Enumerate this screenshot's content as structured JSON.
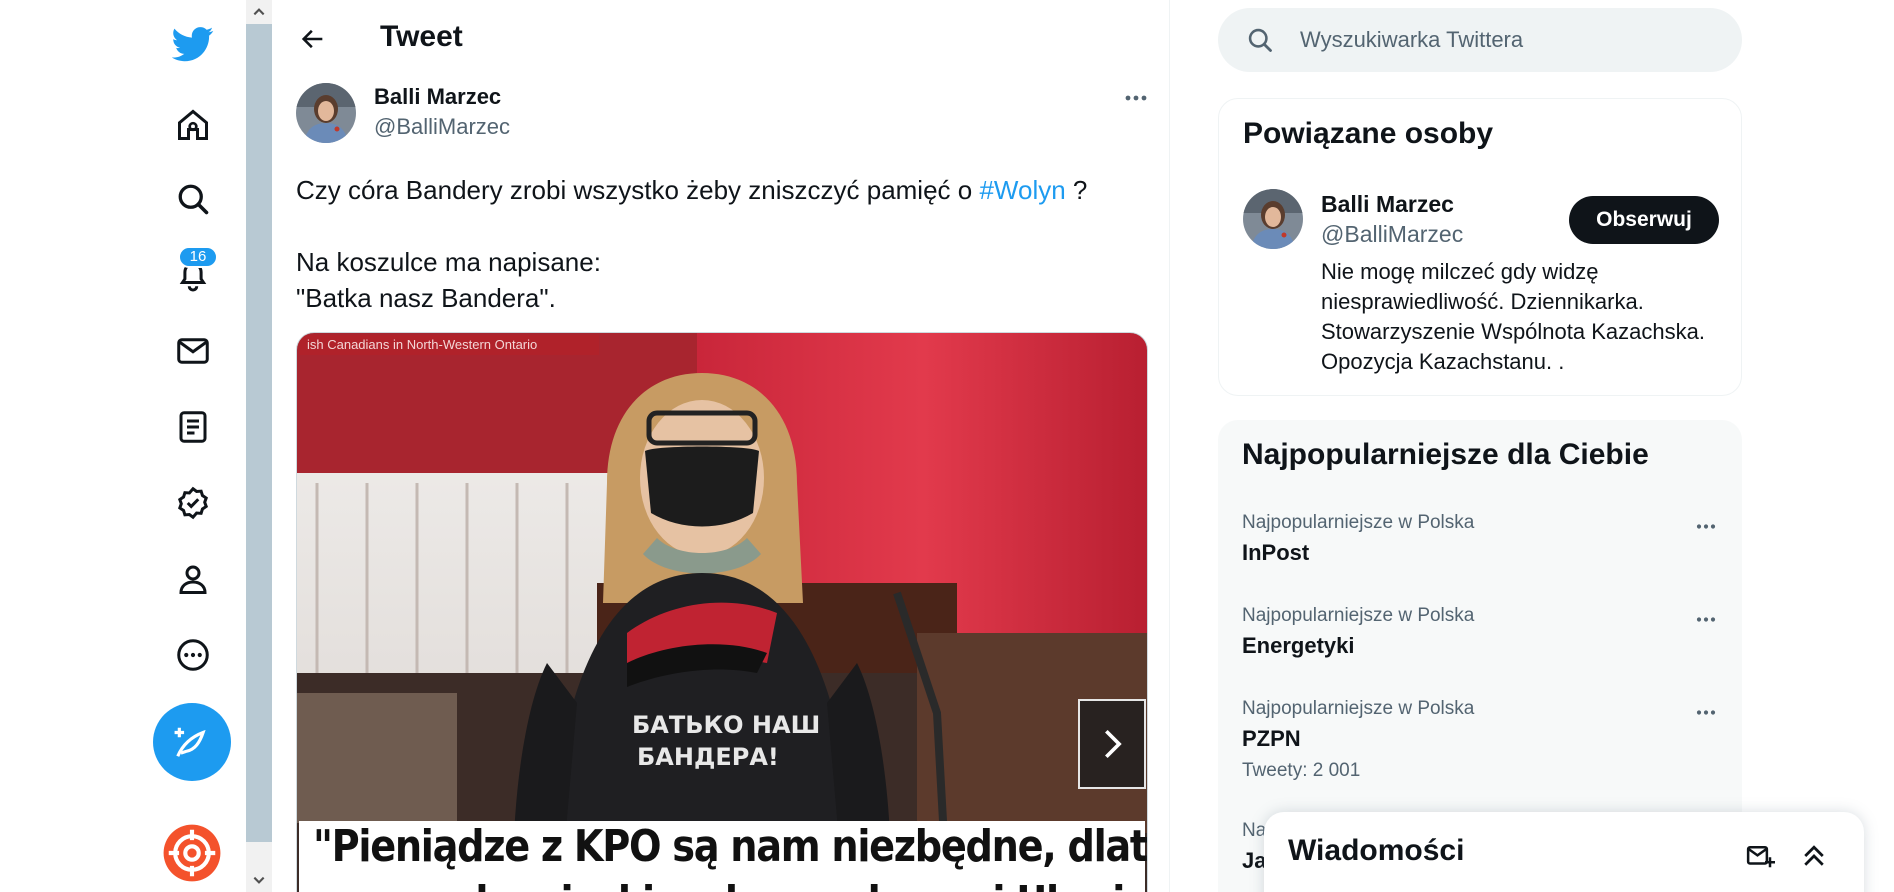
{
  "nav": {
    "icons": [
      "twitter-logo-icon",
      "home-icon",
      "explore-icon",
      "notifications-icon",
      "messages-icon",
      "lists-icon",
      "verified-icon",
      "profile-icon",
      "more-icon"
    ],
    "notifications_badge": "16",
    "accent_color": "#1d9bf0"
  },
  "header": {
    "title": "Tweet"
  },
  "tweet": {
    "author_name": "Balli Marzec",
    "author_handle": "@BalliMarzec",
    "text_before_hashtag": "Czy córa Bandery zrobi wszystko żeby zniszczyć pamięć o ",
    "hashtag": "#Wolyn",
    "text_after_hashtag": " ?\n\nNa koszulce ma napisane:\n\"Batka nasz Bandera\".",
    "media": {
      "ticker": "ish Canadians in North-Western Ontario",
      "shirt_text_line1": "БАТЬКО НАШ",
      "shirt_text_line2": "БАНДЕРА!",
      "caption_line1": "\"Pieniądze z KPO są nam niezbędne, dlatego że",
      "caption_line2": "mamy obowiązki wobec walczącej Ukrainy\" -"
    }
  },
  "search": {
    "placeholder": "Wyszukiwarka Twittera"
  },
  "related": {
    "title": "Powiązane osoby",
    "name": "Balli Marzec",
    "handle": "@BalliMarzec",
    "follow_label": "Obserwuj",
    "bio": "Nie mogę milczeć gdy widzę niesprawiedliwość. Dziennikarka. Stowarzyszenie Wspólnota Kazachska. Opozycja Kazachstanu. ."
  },
  "trends": {
    "title": "Najpopularniejsze dla Ciebie",
    "items": [
      {
        "context": "Najpopularniejsze w Polska",
        "name": "InPost",
        "count": ""
      },
      {
        "context": "Najpopularniejsze w Polska",
        "name": "Energetyki",
        "count": ""
      },
      {
        "context": "Najpopularniejsze w Polska",
        "name": "PZPN",
        "count": "Tweety: 2 001"
      }
    ],
    "partial_context": "Na",
    "partial_name": "Ja"
  },
  "messages": {
    "title": "Wiadomości"
  }
}
